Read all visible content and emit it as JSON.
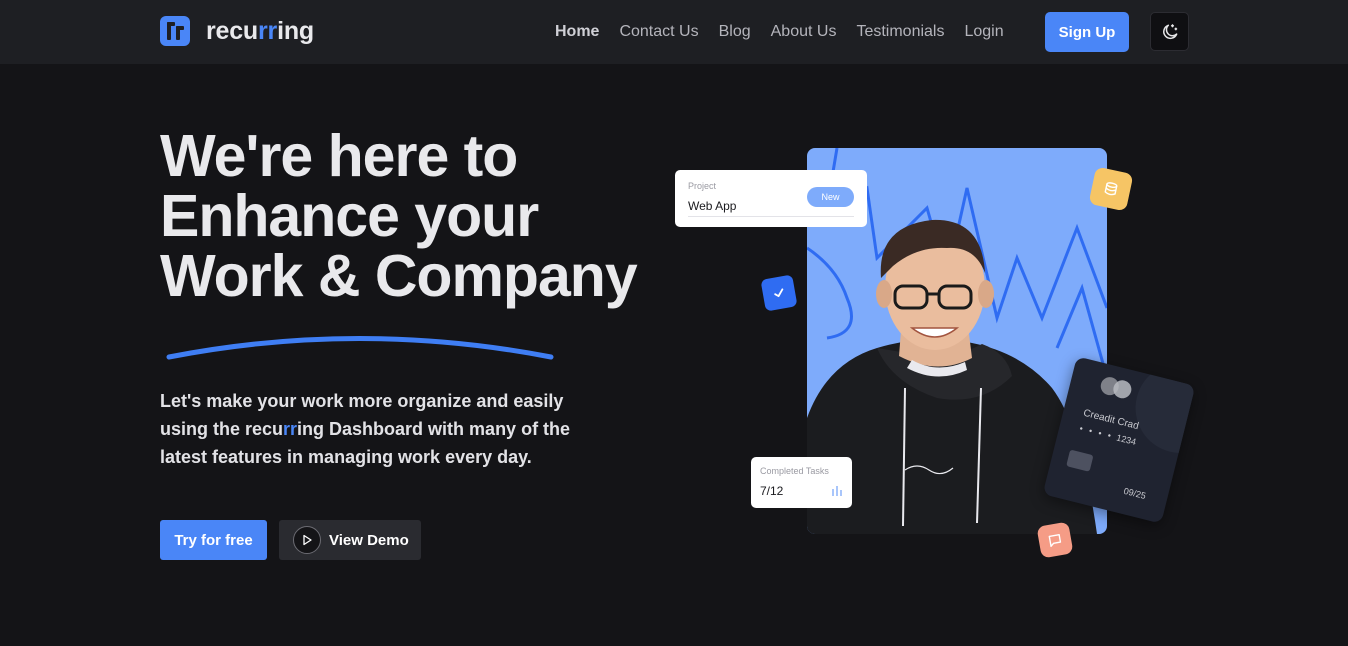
{
  "brand": {
    "name_part1": "recu",
    "name_accent": "rr",
    "name_part2": "ing",
    "accent_color": "#4a86f7"
  },
  "nav": {
    "items": [
      {
        "label": "Home",
        "active": true
      },
      {
        "label": "Contact Us",
        "active": false
      },
      {
        "label": "Blog",
        "active": false
      },
      {
        "label": "About Us",
        "active": false
      },
      {
        "label": "Testimonials",
        "active": false
      },
      {
        "label": "Login",
        "active": false
      }
    ],
    "signup_label": "Sign Up",
    "theme_icon": "moon-stars-icon"
  },
  "hero": {
    "title_lines": [
      "We're here to",
      "Enhance your",
      "Work & Company"
    ],
    "description_part1": "Let's make your work more organize and easily using the recu",
    "description_accent": "rr",
    "description_part2": "ing Dashboard with many of the latest features in managing work every day.",
    "try_label": "Try for free",
    "demo_label": "View Demo"
  },
  "illustration": {
    "project_card": {
      "label": "Project",
      "value": "Web App",
      "badge": "New"
    },
    "tasks_card": {
      "label": "Completed Tasks",
      "value": "7/12"
    },
    "credit_card": {
      "title": "Creadit Crad",
      "masked": "• • • •",
      "last4": "1234",
      "expiry": "09/25"
    },
    "panel_color": "#7eabfb"
  }
}
